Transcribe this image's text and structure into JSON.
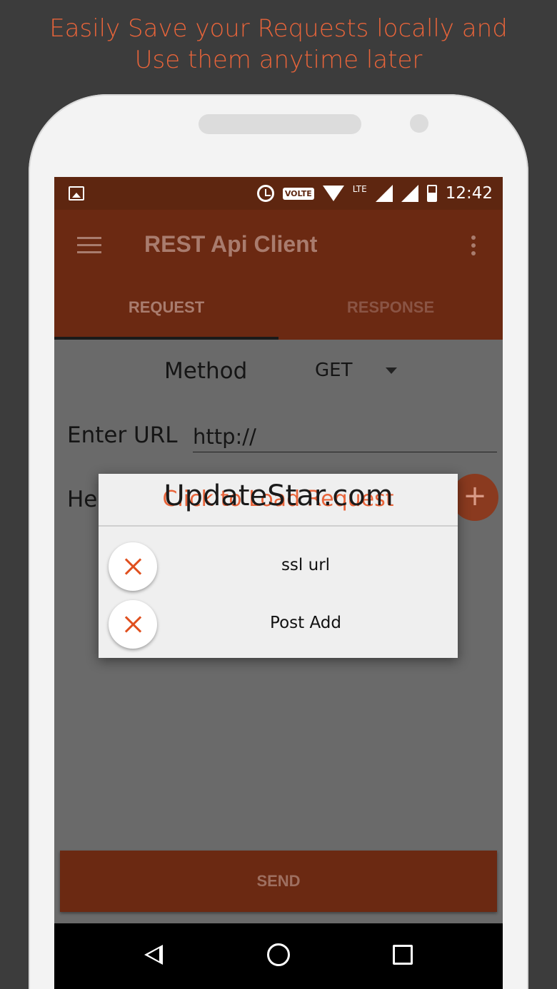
{
  "promo": {
    "line1": "Easily Save your Requests locally and",
    "line2": "Use them anytime later"
  },
  "statusbar": {
    "volte": "VOLTE",
    "lte": "LTE",
    "time": "12:42"
  },
  "appbar": {
    "title": "REST Api Client",
    "tabs": [
      {
        "label": "REQUEST",
        "selected": true
      },
      {
        "label": "RESPONSE",
        "selected": false
      }
    ]
  },
  "form": {
    "method_label": "Method",
    "method_value": "GET",
    "url_label": "Enter URL",
    "url_value": "http://",
    "headers_label": "He",
    "add_symbol": "+",
    "send_label": "SEND"
  },
  "dialog": {
    "title": "Click to Load Request",
    "items": [
      {
        "label": "ssl url"
      },
      {
        "label": "Post Add"
      }
    ]
  },
  "watermark": "UpdateStar.com",
  "colors": {
    "accent": "#e8643a",
    "appbar": "#6b2912",
    "statusbar": "#5e2610"
  }
}
